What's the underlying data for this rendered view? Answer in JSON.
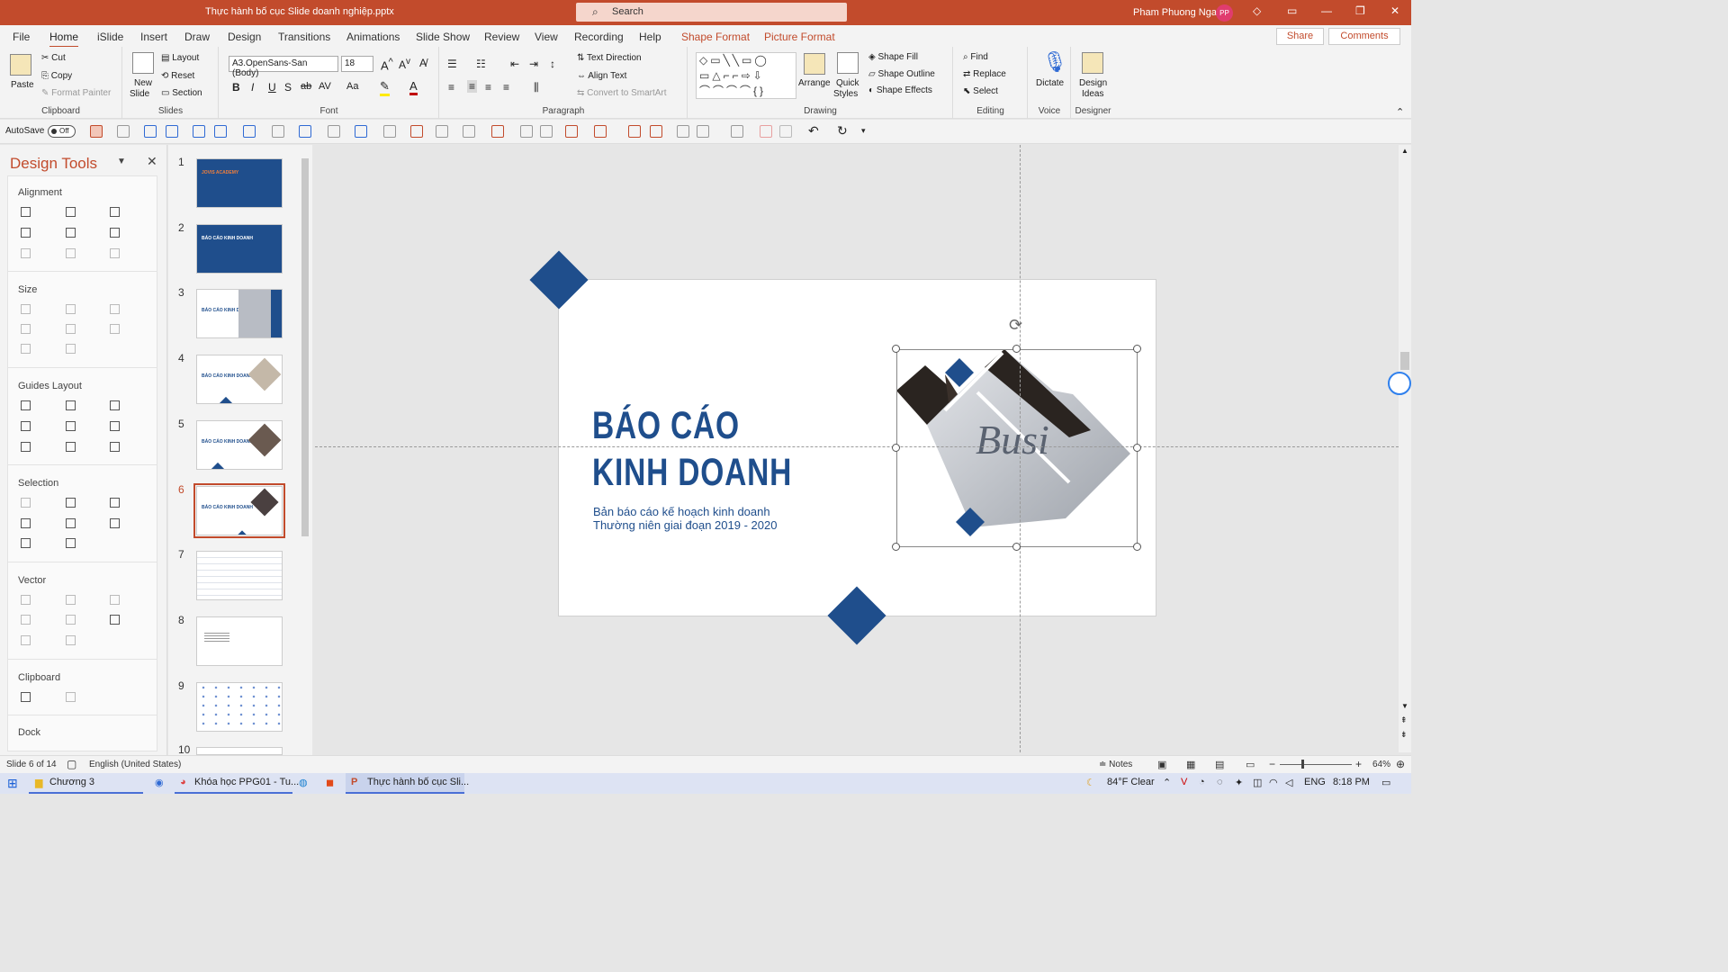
{
  "titlebar": {
    "title": "Thực hành bố cục Slide doanh nghiệp.pptx",
    "search": "Search",
    "user": "Pham Phuong Nga",
    "initials": "PP"
  },
  "menu": {
    "tabs": [
      "File",
      "Home",
      "iSlide",
      "Insert",
      "Draw",
      "Design",
      "Transitions",
      "Animations",
      "Slide Show",
      "Review",
      "View",
      "Recording",
      "Help",
      "Shape Format",
      "Picture Format"
    ],
    "active": "Home",
    "share": "Share",
    "comments": "Comments"
  },
  "ribbon": {
    "clipboard": {
      "paste": "Paste",
      "cut": "Cut",
      "copy": "Copy",
      "format_painter": "Format Painter",
      "label": "Clipboard"
    },
    "slides": {
      "new_slide": "New",
      "new_slide2": "Slide",
      "layout": "Layout",
      "reset": "Reset",
      "section": "Section",
      "label": "Slides"
    },
    "font": {
      "name": "A3.OpenSans-San (Body)",
      "size": "18",
      "label": "Font"
    },
    "paragraph": {
      "text_direction": "Text Direction",
      "align_text": "Align Text",
      "convert": "Convert to SmartArt",
      "label": "Paragraph"
    },
    "drawing": {
      "arrange": "Arrange",
      "quick": "Quick",
      "styles": "Styles",
      "fill": "Shape Fill",
      "outline": "Shape Outline",
      "effects": "Shape Effects",
      "label": "Drawing"
    },
    "editing": {
      "find": "Find",
      "replace": "Replace",
      "select": "Select",
      "label": "Editing"
    },
    "voice": {
      "dictate": "Dictate",
      "label": "Voice"
    },
    "designer": {
      "design": "Design",
      "ideas": "Ideas",
      "label": "Designer"
    }
  },
  "qat": {
    "autosave": "AutoSave",
    "toggle": "Off"
  },
  "design_tools": {
    "title": "Design Tools",
    "sections": [
      "Alignment",
      "Size",
      "Guides Layout",
      "Selection",
      "Vector",
      "Clipboard",
      "Dock"
    ]
  },
  "thumbnails": [
    {
      "num": "1",
      "text": "JOVIS ACADEMY"
    },
    {
      "num": "2",
      "text": "BÁO CÁO KINH DOANH"
    },
    {
      "num": "3",
      "text": "BÁO CÁO KINH DOANH"
    },
    {
      "num": "4",
      "text": "BÁO CÁO KINH DOANH"
    },
    {
      "num": "5",
      "text": "BÁO CÁO KINH DOANH"
    },
    {
      "num": "6",
      "text": "BÁO CÁO KINH DOANH"
    },
    {
      "num": "7",
      "text": ""
    },
    {
      "num": "8",
      "text": ""
    },
    {
      "num": "9",
      "text": ""
    },
    {
      "num": "10",
      "text": ""
    }
  ],
  "slide": {
    "title_line1": "BÁO CÁO",
    "title_line2": "KINH DOANH",
    "subtitle1": "Bản báo cáo kế hoạch kinh doanh",
    "subtitle2": "Thường niên giai đoạn 2019 - 2020",
    "picture_text": "Busi"
  },
  "status": {
    "slide": "Slide 6 of 14",
    "language": "English (United States)",
    "notes": "Notes",
    "zoom": "64%"
  },
  "taskbar": {
    "chuong": "Chương 3",
    "khoahoc": "Khóa học PPG01 - Tu...",
    "thuchanh": "Thực hành bố cục Sli...",
    "weather": "84°F  Clear",
    "lang": "ENG",
    "time": "8:18 PM"
  },
  "colors": {
    "accent": "#c24b2c",
    "brand_blue": "#1f4e8c"
  }
}
